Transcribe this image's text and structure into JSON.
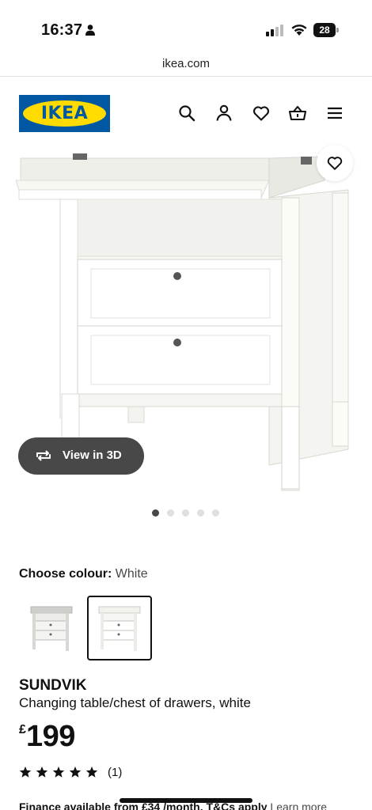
{
  "status_bar": {
    "time": "16:37",
    "battery": "28"
  },
  "browser": {
    "url": "ikea.com"
  },
  "header": {
    "logo_text": "IKEA",
    "icons": [
      "search-icon",
      "account-icon",
      "heart-icon",
      "basket-icon",
      "menu-icon"
    ]
  },
  "gallery": {
    "view_3d_label": "View in 3D",
    "slide_count": 5,
    "active_slide": 1
  },
  "colour": {
    "label": "Choose colour:",
    "value": "White",
    "swatch_count": 2,
    "selected_swatch": 2
  },
  "product": {
    "name": "SUNDVIK",
    "description": "Changing table/chest of drawers, white",
    "currency": "£",
    "price": "199",
    "rating": 5,
    "rating_max": 5,
    "review_count": "(1)"
  },
  "finance": {
    "text": "Finance available from £34 /month. T&Cs apply",
    "link": "Learn more"
  },
  "colors": {
    "brand_blue": "#0058a3",
    "brand_yellow": "#ffdb00",
    "pill_bg": "#484848"
  }
}
